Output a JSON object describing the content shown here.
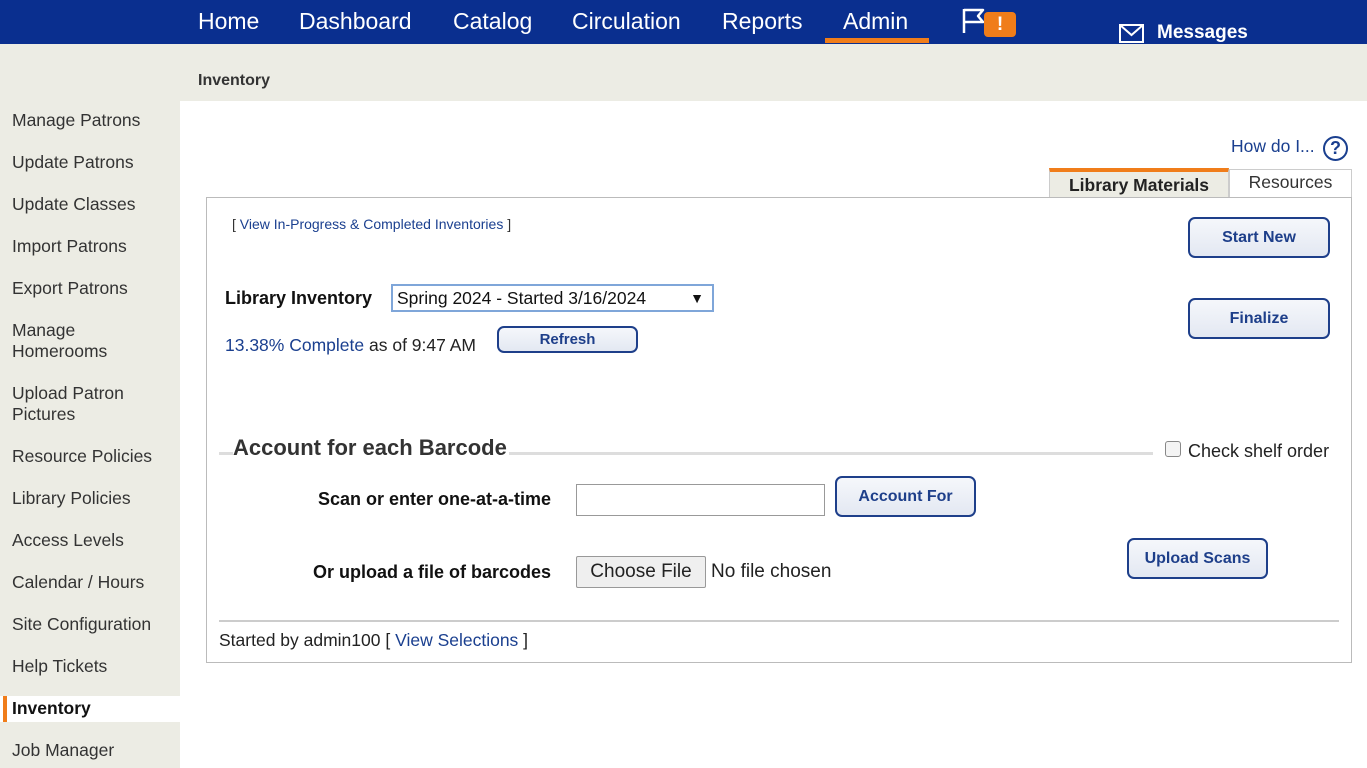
{
  "nav": {
    "items": [
      "Home",
      "Dashboard",
      "Catalog",
      "Circulation",
      "Reports",
      "Admin"
    ],
    "alert_badge": "!",
    "messages_label": "Messages",
    "accent_color": "#f07d1a",
    "bar_color": "#0a2f8f"
  },
  "subheader": {
    "title": "Inventory"
  },
  "sidebar": {
    "items": [
      "Manage Patrons",
      "Update Patrons",
      "Update Classes",
      "Import Patrons",
      "Export Patrons",
      "Manage Homerooms",
      "Upload Patron Pictures",
      "Resource Policies",
      "Library Policies",
      "Access Levels",
      "Calendar / Hours",
      "Site Configuration",
      "Help Tickets",
      "Inventory",
      "Job Manager"
    ],
    "active": "Inventory"
  },
  "help": {
    "label": "How do I...",
    "icon": "?"
  },
  "tabs": [
    {
      "label": "Library Materials",
      "active": true
    },
    {
      "label": "Resources",
      "active": false
    }
  ],
  "panel": {
    "link_open": "[ ",
    "view_inventories_link": "View In-Progress & Completed Inventories",
    "link_close": " ]",
    "start_new_button": "Start New",
    "finalize_button": "Finalize",
    "inventory_label": "Library Inventory",
    "inventory_selected": "Spring 2024 - Started 3/16/2024",
    "select_arrow": "▼",
    "complete_link": "13.38% Complete",
    "as_of_text": " as of 9:47 AM",
    "refresh_button": "Refresh",
    "section_title": "Account for each Barcode",
    "check_shelf_label": "Check shelf order",
    "scan_label": "Scan or enter one-at-a-time",
    "scan_value": "",
    "account_for_button": "Account For",
    "upload_label": "Or upload a file of barcodes",
    "choose_file_button": "Choose File",
    "no_file_text": "No file chosen",
    "upload_scans_button": "Upload Scans",
    "started_by_text": "Started by admin100  ",
    "view_selections_link": "View Selections",
    "sel_open": "[ ",
    "sel_close": " ]"
  }
}
